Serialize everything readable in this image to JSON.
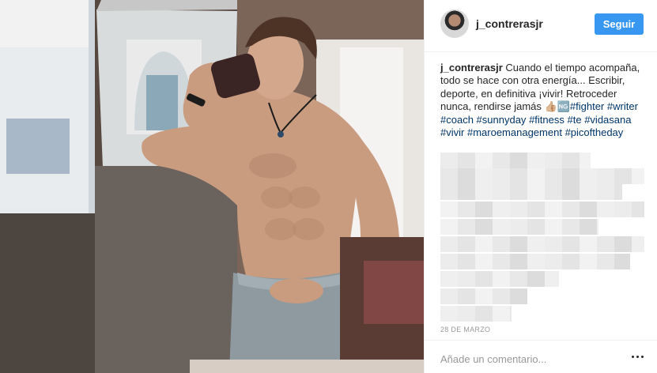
{
  "post": {
    "username": "j_contreras",
    "username_suffix": "jr",
    "follow_label": "Seguir",
    "caption_author": "j_contrerasjr",
    "caption_text": " Cuando el tiempo acompaña, todo se hace con otra energía... Escribir, deporte, en definitiva ¡vivir! Retroceder nunca, rendirse jamás ",
    "caption_emoji": "👍🏼🆖",
    "hashtags": [
      "#fighter",
      "#writer",
      "#coach",
      "#sunnyday",
      "#fitness",
      "#te",
      "#vidasana",
      "#vivir",
      "#maroemanagement",
      "#picoftheday"
    ],
    "date": "28 DE MARZO",
    "comment_placeholder": "Añade un comentario...",
    "colors": {
      "accent": "#3897f0",
      "hashtag": "#003569"
    }
  }
}
